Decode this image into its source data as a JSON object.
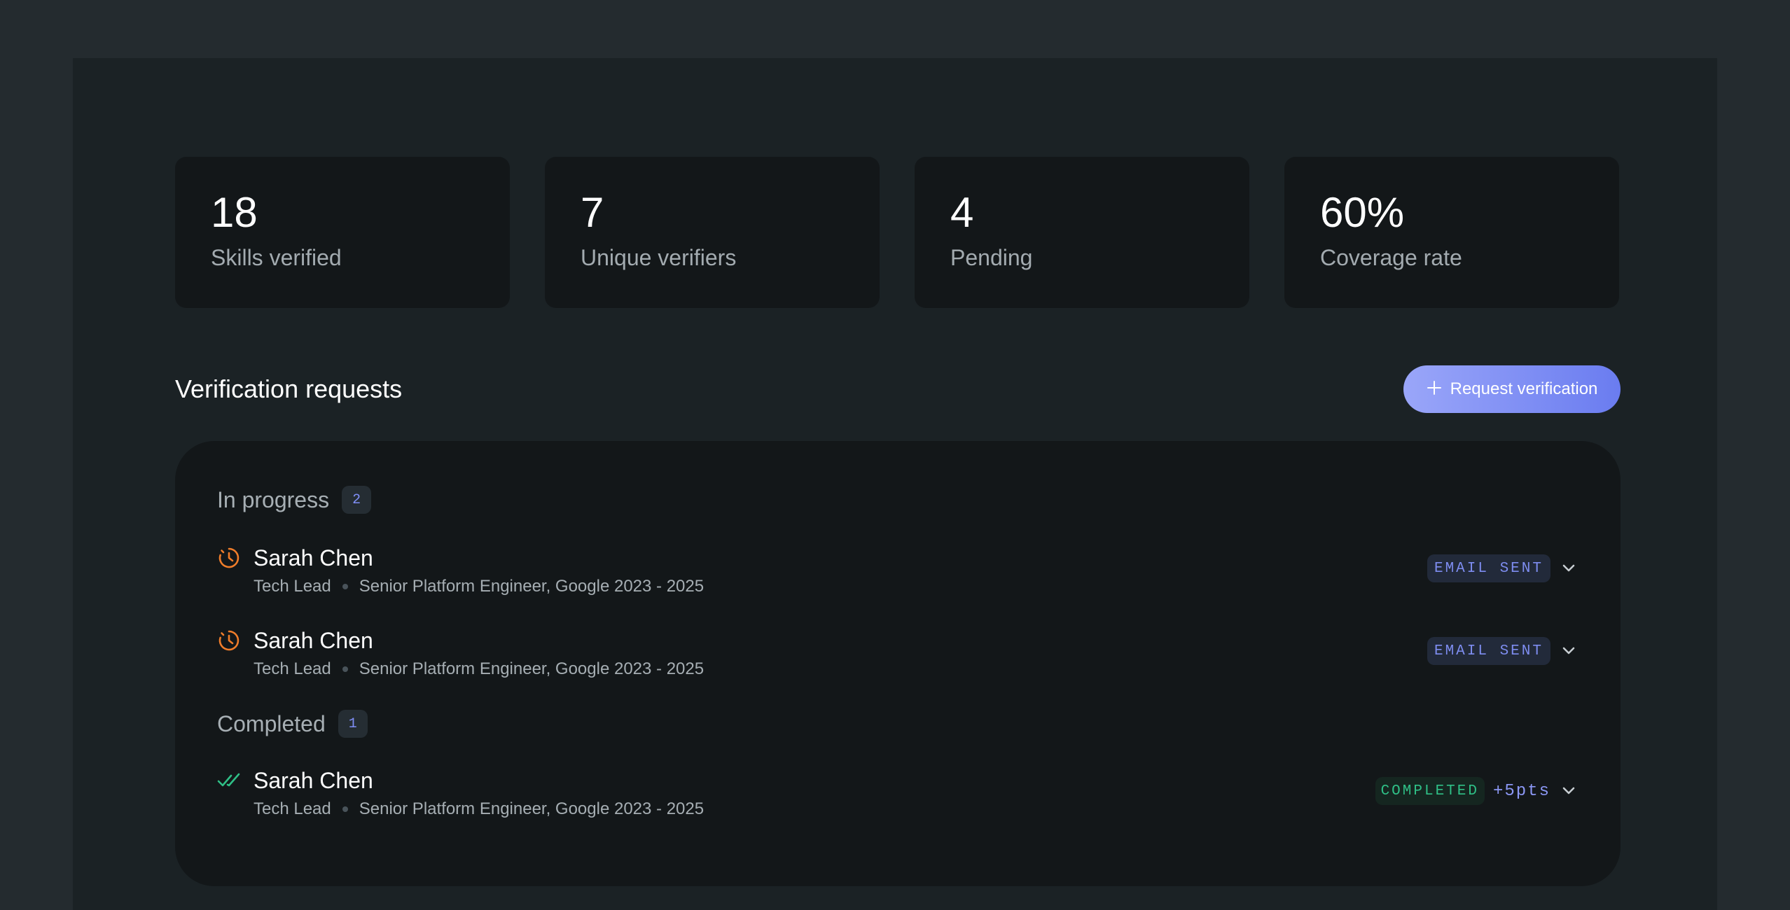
{
  "stats": [
    {
      "value": "18",
      "label": "Skills verified"
    },
    {
      "value": "7",
      "label": "Unique verifiers"
    },
    {
      "value": "4",
      "label": "Pending"
    },
    {
      "value": "60%",
      "label": "Coverage rate"
    }
  ],
  "section": {
    "title": "Verification requests",
    "request_button": "Request verification"
  },
  "groups": {
    "in_progress": {
      "title": "In progress",
      "count": "2",
      "items": [
        {
          "name": "Sarah Chen",
          "role": "Tech Lead",
          "detail": "Senior Platform Engineer, Google 2023 - 2025",
          "status": "EMAIL SENT",
          "icon": "clock-icon"
        },
        {
          "name": "Sarah Chen",
          "role": "Tech Lead",
          "detail": "Senior Platform Engineer, Google 2023 - 2025",
          "status": "EMAIL SENT",
          "icon": "clock-icon"
        }
      ]
    },
    "completed": {
      "title": "Completed",
      "count": "1",
      "items": [
        {
          "name": "Sarah Chen",
          "role": "Tech Lead",
          "detail": "Senior Platform Engineer, Google 2023 - 2025",
          "status": "COMPLETED",
          "points": "+5pts",
          "icon": "double-check-icon"
        }
      ]
    }
  },
  "colors": {
    "accent": "#7e8df0",
    "pending_icon": "#f07d2a",
    "success": "#2fbf86"
  }
}
